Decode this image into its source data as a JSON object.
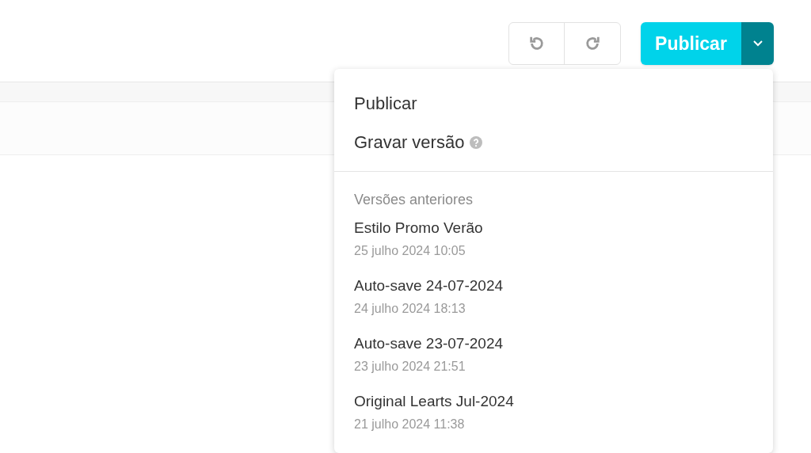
{
  "toolbar": {
    "publish_button": "Publicar"
  },
  "menu": {
    "actions": [
      {
        "label": "Publicar",
        "help": false
      },
      {
        "label": "Gravar versão",
        "help": true
      }
    ],
    "section_title": "Versões anteriores",
    "versions": [
      {
        "name": "Estilo Promo Verão",
        "date": "25 julho 2024 10:05"
      },
      {
        "name": "Auto-save 24-07-2024",
        "date": "24 julho 2024 18:13"
      },
      {
        "name": "Auto-save 23-07-2024",
        "date": "23 julho 2024 21:51"
      },
      {
        "name": "Original Learts Jul-2024",
        "date": "21 julho 2024 11:38"
      }
    ]
  }
}
